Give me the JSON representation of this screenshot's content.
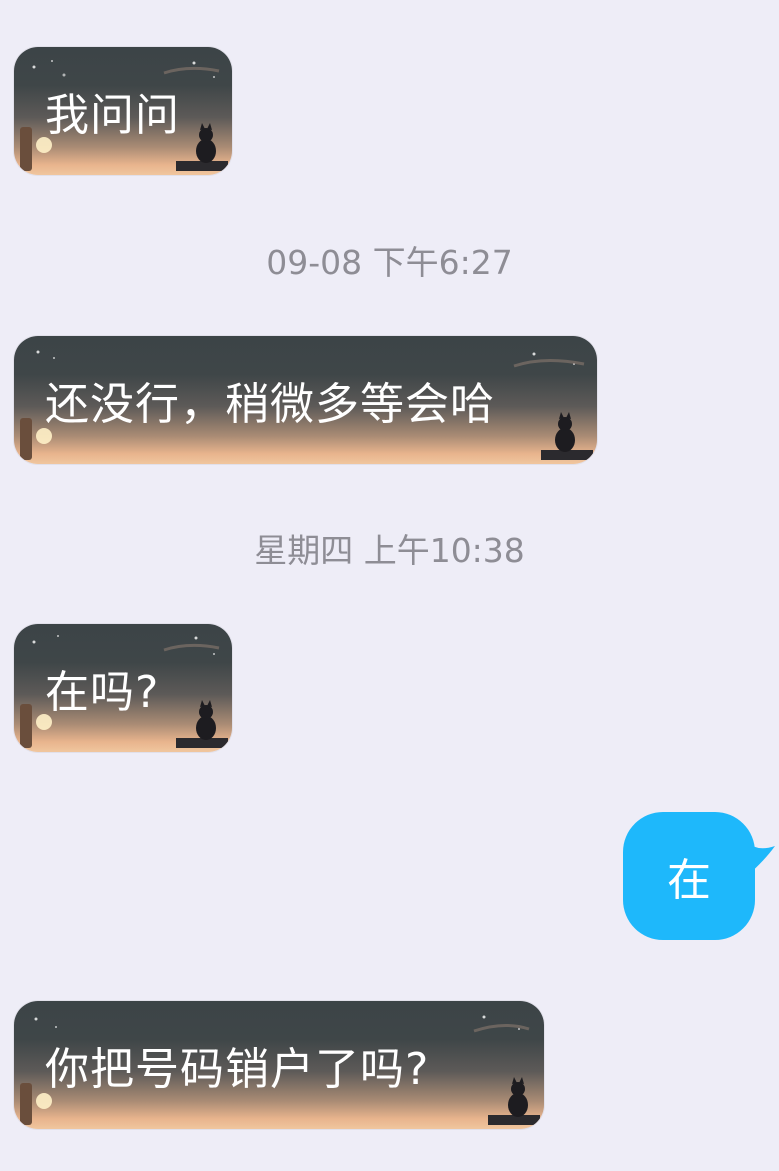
{
  "messages": [
    {
      "side": "incoming",
      "text": "我问问"
    },
    {
      "side": "incoming",
      "text": "还没行，稍微多等会哈"
    },
    {
      "side": "incoming",
      "text": "在吗?"
    },
    {
      "side": "outgoing",
      "text": "在"
    },
    {
      "side": "incoming",
      "text": "你把号码销户了吗?"
    }
  ],
  "timestamps": [
    "09-08 下午6:27",
    "星期四 上午10:38"
  ],
  "colors": {
    "background": "#eeedf7",
    "outgoing_bubble": "#1eb8fb",
    "timestamp_text": "#8e8d95"
  }
}
